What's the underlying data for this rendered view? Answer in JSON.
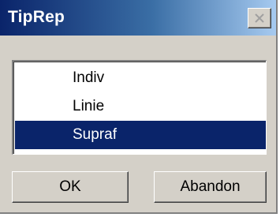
{
  "window": {
    "title": "TipRep"
  },
  "list": {
    "items": [
      {
        "label": "Indiv",
        "selected": false
      },
      {
        "label": "Linie",
        "selected": false
      },
      {
        "label": "Supraf",
        "selected": true
      }
    ]
  },
  "buttons": {
    "ok_label": "OK",
    "cancel_label": "Abandon"
  },
  "colors": {
    "title_gradient_start": "#0a246a",
    "title_gradient_end": "#a6caf0",
    "selection": "#0a246a",
    "face": "#d4d0c8"
  }
}
